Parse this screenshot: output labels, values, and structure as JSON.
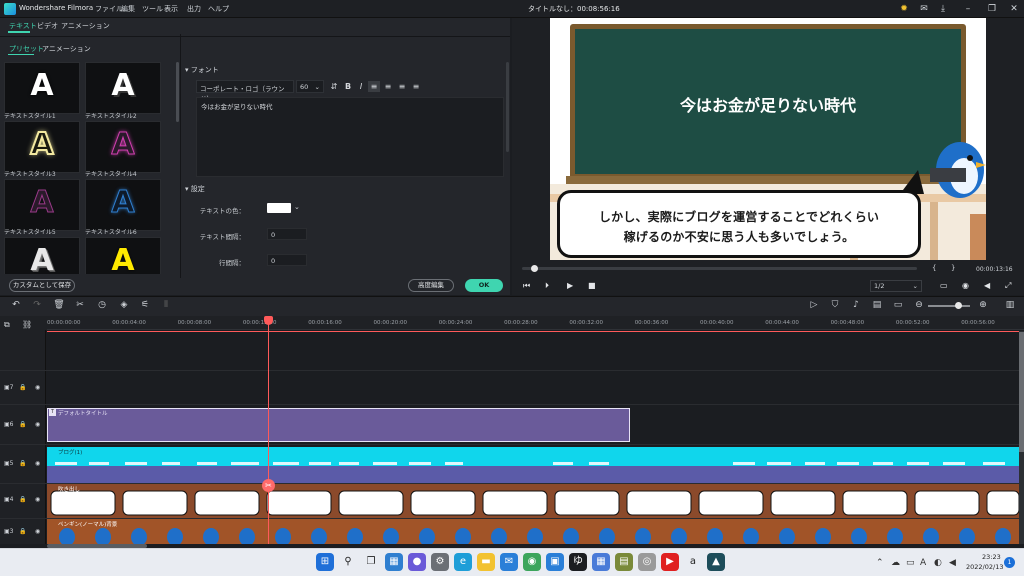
{
  "titlebar": {
    "app_name": "Wondershare Filmora",
    "menu": [
      "ファイル",
      "編集",
      "ツール",
      "表示",
      "出力",
      "ヘルプ"
    ],
    "doc_title": "タイトルなし：00:08:56:16",
    "icons": [
      "lightbulb-icon",
      "mail-icon",
      "download-icon",
      "minimize-icon",
      "restore-icon",
      "close-icon"
    ]
  },
  "left_panel": {
    "main_tabs": [
      "テキスト",
      "ビデオ",
      "アニメーション"
    ],
    "sub_tabs": [
      "プリセット",
      "アニメーション"
    ],
    "presets": [
      {
        "label": "テキストスタイル1",
        "color": "#ffffff",
        "glow": "#000000"
      },
      {
        "label": "テキストスタイル2",
        "color": "#ffffff",
        "glow": "#000000"
      },
      {
        "label": "テキストスタイル3",
        "color": "#000000",
        "glow": "#f3e9a0"
      },
      {
        "label": "テキストスタイル4",
        "color": "#2a1a2a",
        "glow": "#d13fb0"
      },
      {
        "label": "テキストスタイル5",
        "color": "#2a1a2a",
        "glow": "#9b3a8a"
      },
      {
        "label": "テキストスタイル6",
        "color": "#0e1a2a",
        "glow": "#2f7fd0"
      },
      {
        "label": "",
        "color": "#ffffff",
        "glow": "#888888"
      },
      {
        "label": "",
        "color": "#ffea00",
        "glow": "#000000"
      }
    ],
    "font_section_title": "フォント",
    "font_name": "コーポレート・ロゴ（ラウンド）",
    "font_size": "60",
    "text_value": "今はお金が足りない時代",
    "settings_title": "設定",
    "settings": [
      {
        "label": "テキストの色：",
        "value": ""
      },
      {
        "label": "テキスト間隔：",
        "value": "0"
      },
      {
        "label": "行間隔：",
        "value": "0"
      }
    ],
    "save_custom": "カスタムとして保存",
    "advanced": "高度編集",
    "ok": "OK"
  },
  "preview": {
    "blackboard_text": "今はお金が足りない時代",
    "caption_line1": "しかし、実際にブログを運営することでどれくらい",
    "caption_line2": "稼げるのか不安に思う人も多いでしょう。",
    "time": "00:00:13:16",
    "ratio": "1/2",
    "progress": 0.03
  },
  "timeline": {
    "ruler": [
      "00:00:00:00",
      "00:00:04:00",
      "00:00:08:00",
      "00:00:12:00",
      "00:00:16:00",
      "00:00:20:00",
      "00:00:24:00",
      "00:00:28:00",
      "00:00:32:00",
      "00:00:36:00",
      "00:00:40:00",
      "00:00:44:00",
      "00:00:48:00",
      "00:00:52:00",
      "00:00:56:00"
    ],
    "track_numbers": [
      "7",
      "6",
      "5",
      "4",
      "3"
    ],
    "clip_title": "デフォルトタイトル",
    "clip_audio": "ブログ(1)",
    "clip_frames": "吹き出し",
    "clip_peng": "ペンギン(ノーマル)背景"
  },
  "taskbar": {
    "time": "23:23",
    "date": "2022/02/13",
    "notifications": "1",
    "apps": [
      {
        "name": "windows-start-icon",
        "color": "#1f6fd8",
        "glyph": "⊞"
      },
      {
        "name": "search-icon",
        "color": "#e9ecf2",
        "glyph": "⚲"
      },
      {
        "name": "task-view-icon",
        "color": "#e9ecf2",
        "glyph": "❐"
      },
      {
        "name": "widgets-icon",
        "color": "#2f7fd0",
        "glyph": "▦"
      },
      {
        "name": "chat-icon",
        "color": "#6a5ad8",
        "glyph": "●"
      },
      {
        "name": "settings-icon",
        "color": "#6b6f75",
        "glyph": "⚙"
      },
      {
        "name": "edge-icon",
        "color": "#1e9ed8",
        "glyph": "e"
      },
      {
        "name": "explorer-icon",
        "color": "#f2c230",
        "glyph": "▬"
      },
      {
        "name": "mail-app-icon",
        "color": "#2a7fd8",
        "glyph": "✉"
      },
      {
        "name": "chrome-icon",
        "color": "#3ca55c",
        "glyph": "◉"
      },
      {
        "name": "store-icon",
        "color": "#2a7fd8",
        "glyph": "▣"
      },
      {
        "name": "photos-icon",
        "color": "#1b1d21",
        "glyph": "ゆ"
      },
      {
        "name": "app-icon",
        "color": "#4a7bd8",
        "glyph": "▦"
      },
      {
        "name": "notepad-icon",
        "color": "#7a8a3a",
        "glyph": "▤"
      },
      {
        "name": "app2-icon",
        "color": "#9a9a9a",
        "glyph": "◎"
      },
      {
        "name": "youtube-icon",
        "color": "#e02020",
        "glyph": "▶"
      },
      {
        "name": "amazon-icon",
        "color": "#e9ecf2",
        "glyph": "a"
      },
      {
        "name": "filmora-icon",
        "color": "#1d4d5a",
        "glyph": "▲"
      }
    ]
  }
}
